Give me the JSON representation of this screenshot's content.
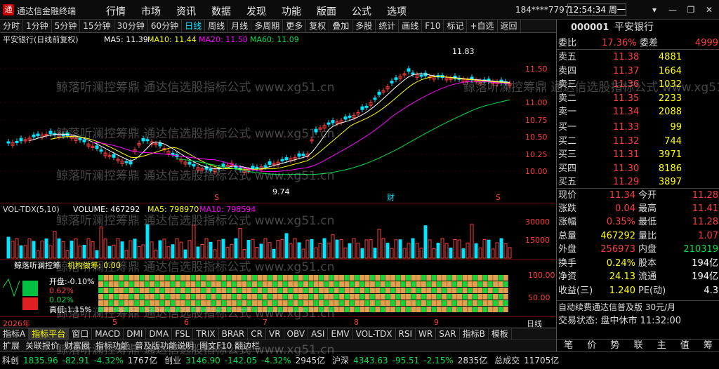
{
  "app": {
    "name": "通达信金融终端",
    "logo": "通"
  },
  "menu": [
    "行情",
    "市场",
    "资讯",
    "数据",
    "发现",
    "功能",
    "版面",
    "公式",
    "选项"
  ],
  "user": "184****7797",
  "clock": "12:54:34 周一",
  "window_buttons": [
    "▾",
    "—",
    "❐",
    "✕"
  ],
  "toolbar": [
    "分时",
    "1分钟",
    "5分钟",
    "15分钟",
    "30分钟",
    "60分钟",
    "日线",
    "周线",
    "月线",
    "多周期",
    "更多",
    "复权",
    "叠加",
    "多股",
    "统计",
    "画线",
    "F10",
    "标记",
    "+自选",
    "返回"
  ],
  "toolbar_active": "日线",
  "chart_legend": {
    "name": "平安银行(日线前复权)",
    "ma5": "MA5: 11.39",
    "ma10": "MA10: 11.44",
    "ma20": "MA20: 11.50",
    "ma60": "MA60: 11.09"
  },
  "chart_annotations": {
    "high": "11.83",
    "low": "9.74",
    "s1": "S",
    "cai": "财",
    "s2": "S"
  },
  "vol_legend": {
    "name": "VOL-TDX(5,10)",
    "volume": "VOLUME: 467292",
    "ma5": "MA5: 798970",
    "ma10": "MA10: 798594"
  },
  "ind_legend": {
    "name": "鲸落听澜控筹",
    "value": "机构做筹: 0.00"
  },
  "ind_panel": {
    "open": "开盘:-0.10%",
    "pct": "0.62%",
    "low": "0.02%",
    "high": "高低:1.15%"
  },
  "xaxis_labels": [
    "2026年",
    "5",
    "6",
    "7",
    "8",
    "9"
  ],
  "period_label": "日线",
  "tabs1": [
    "指标A",
    "指标平台",
    "窗口",
    "MACD",
    "DMI",
    "DMA",
    "FSL",
    "TRIX",
    "BRAR",
    "CR",
    "VR",
    "OBV",
    "ASI",
    "EMV",
    "VOL-TDX",
    "RSI",
    "WR",
    "SAR",
    "指标B",
    "模板"
  ],
  "tabs1_active": "指标平台",
  "tabs2": [
    "扩展",
    "关联报价",
    "财富圈",
    "指标功能",
    "普及版功能说明",
    "图文F10 翻边栏"
  ],
  "quote": {
    "code": "000001",
    "name": "平安银行",
    "weibi_label": "委比",
    "weibi": "17.36%",
    "weicha_label": "委差",
    "weicha": "4999",
    "asks": [
      {
        "label": "卖五",
        "price": "11.38",
        "vol": "4881"
      },
      {
        "label": "卖四",
        "price": "11.37",
        "vol": "1664"
      },
      {
        "label": "卖三",
        "price": "11.36",
        "vol": "1032"
      },
      {
        "label": "卖二",
        "price": "11.35",
        "vol": "2233"
      },
      {
        "label": "卖一",
        "price": "11.34",
        "vol": "2088"
      }
    ],
    "bids": [
      {
        "label": "买一",
        "price": "11.33",
        "vol": "99"
      },
      {
        "label": "买二",
        "price": "11.32",
        "vol": "744"
      },
      {
        "label": "买三",
        "price": "11.31",
        "vol": "3971"
      },
      {
        "label": "买四",
        "price": "11.30",
        "vol": "8186"
      },
      {
        "label": "买五",
        "price": "11.29",
        "vol": "3897"
      }
    ],
    "stats": [
      {
        "l": "现价",
        "v": "11.34",
        "l2": "今开",
        "v2": "11.28"
      },
      {
        "l": "涨跌",
        "v": "0.04",
        "l2": "最高",
        "v2": "11.41"
      },
      {
        "l": "涨幅",
        "v": "0.35%",
        "l2": "最低",
        "v2": "11.28"
      },
      {
        "l": "总量",
        "v": "467292",
        "l2": "量比",
        "v2": "1.07"
      },
      {
        "l": "外盘",
        "v": "256973",
        "l2": "内盘",
        "v2": "210319"
      },
      {
        "l": "换手",
        "v": "0.24%",
        "l2": "股本",
        "v2": "194亿"
      },
      {
        "l": "净资",
        "v": "24.13",
        "l2": "流通",
        "v2": "194亿"
      },
      {
        "l": "收益(三)",
        "v": "1.240",
        "l2": "PE(动)",
        "v2": "4.3"
      }
    ],
    "promo": "自动续费通达信普及版 30元/月",
    "trade_status": "交易状态: 盘中休市 11:32:00",
    "bottom_tabs": [
      "笔",
      "价",
      "势",
      "联",
      "主",
      "值",
      "筹"
    ]
  },
  "statusbar": {
    "items": [
      {
        "name": "科创",
        "val": "1835.96",
        "chg": "-82.91",
        "pct": "-4.32%",
        "amt": "1767亿"
      },
      {
        "name": "创业",
        "val": "3146.90",
        "chg": "-142.05",
        "pct": "-4.32%",
        "amt": "2945亿"
      },
      {
        "name": "沪深",
        "val": "4343.63",
        "chg": "-95.51",
        "pct": "-2.15%",
        "amt": "2835亿"
      }
    ],
    "total_label": "总成交",
    "total": "11705亿"
  },
  "watermark": "鲸落听澜控筹鼎 通达信选股指标公式 www.xg51.cn",
  "colors": {
    "up": "#ff3c3c",
    "down": "#00e5ff",
    "ma5": "#ffffff",
    "ma10": "#ffff00",
    "ma20": "#ff00ff",
    "ma60": "#00e04a"
  }
}
